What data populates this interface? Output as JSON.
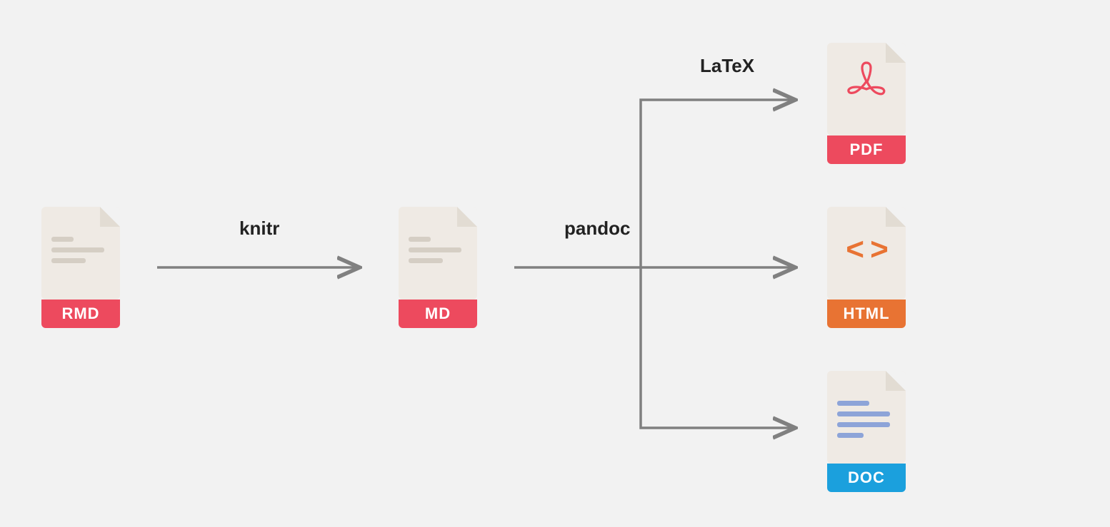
{
  "files": {
    "rmd": {
      "label": "RMD"
    },
    "md": {
      "label": "MD"
    },
    "pdf": {
      "label": "PDF"
    },
    "html": {
      "label": "HTML"
    },
    "doc": {
      "label": "DOC"
    }
  },
  "arrows": {
    "knitr": "knitr",
    "pandoc": "pandoc",
    "latex": "LaTeX"
  }
}
